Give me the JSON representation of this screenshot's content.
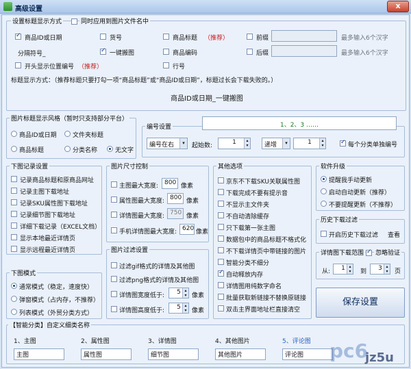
{
  "window": {
    "title": "高级设置",
    "close_label": "x"
  },
  "title_group": {
    "legend": "设置标题显示方式",
    "sync_label": "同时应用到图片文件名中",
    "opt_product_id_date": "商品ID或日期",
    "opt_sku": "货号",
    "opt_product_title": "商品标题",
    "opt_recommend": "（推荐）",
    "opt_prefix": "前缀",
    "hint_max6_a": "最多输入6个汉字",
    "separator_label": "分隔符号_",
    "opt_one_key": "一键搬图",
    "opt_product_code": "商品编码",
    "opt_suffix": "后缀",
    "hint_max6_b": "最多输入6个汉字",
    "opt_start_num": "开头显示位置编号",
    "opt_recommend2": "（推荐）",
    "opt_row": "行号",
    "method_text": "标题显示方式：（推荐标题只要打勾一项“商品标题”或“商品ID或日期”，标题过长会下载失败的。）",
    "preview_text": "商品ID或日期_一键搬图"
  },
  "style_group": {
    "legend": "图片标题显示风格（暂时只支持部分平台）",
    "opt_id_date": "商品ID或日期",
    "opt_filename": "文件夹标题",
    "opt_title": "商品标题",
    "opt_category": "分类名称",
    "opt_none": "无文字",
    "numbering_legend": "编号设置",
    "numbering_preview": "1、2、3 ……",
    "pos_select": "编号在右",
    "start_label": "起始数:",
    "start_value": "1",
    "increment_select": "递增",
    "step_value": "1",
    "per_category_label": "每个分类单独编号"
  },
  "record_group": {
    "legend": "下图记录设置",
    "items": [
      "记录商品标题和原商品网址",
      "记录主图下载地址",
      "记录SKU属性图下载地址",
      "记录细节图下载地址",
      "详细下载记录（EXCEL文档）",
      "显示本地最近详情页",
      "显示远程最近详情页"
    ]
  },
  "size_group": {
    "legend": "图片尺寸控制",
    "main_label": "主图最大宽度:",
    "main_value": "800",
    "main_unit": "像素",
    "attr_label": "属性图最大宽度:",
    "attr_value": "800",
    "attr_unit": "像素",
    "detail_label": "详情图最大宽度:",
    "detail_value": "750",
    "detail_unit": "像素",
    "mobile_label": "手机详情图最大宽度:",
    "mobile_value": "620",
    "mobile_unit": "像素"
  },
  "other_group": {
    "legend": "其他选项",
    "items": [
      "京东不下载SKU关联属性图",
      "下载完成不要有提示音",
      "不显示主文件夹",
      "不自动清除缓存",
      "只下载第一张主图",
      "数据包中的商品标题不格式化",
      "不下载详情页中带链接的图片",
      "智能分类不细分",
      "自动释放内存",
      "详情图用纯数字命名",
      "批量获取新链接不替换原链接",
      "双击主界面地址栏直接清空"
    ]
  },
  "upgrade_group": {
    "legend": "软件升级",
    "opt_remind": "提醒我手动更新",
    "opt_auto": "启动自动更新（推荐）",
    "opt_none": "不要提醒更新（不推荐）"
  },
  "history_group": {
    "legend": "历史下载过滤",
    "enable_label": "开启历史下载过滤",
    "view_label": "查看"
  },
  "detail_range_group": {
    "legend": "详情图下载范围",
    "ignore_label": "忽略验证",
    "from_label": "从:",
    "from_value": "1",
    "to_label": "到",
    "to_value": "3",
    "page_label": "页"
  },
  "save_button": "保存设置",
  "download_mode_group": {
    "legend": "下图模式",
    "opt_normal": "通常模式（稳定，速度快）",
    "opt_popup": "弹窗模式（占内存，不推荐）",
    "opt_list": "列表模式（外贸分类方式）"
  },
  "filter_group": {
    "legend": "图片过滤设置",
    "gif_label": "过滤gif格式的详情及其他图",
    "png_label": "过滤png格式的详情及其他图",
    "width_label": "详情图宽度低于:",
    "width_value": "5",
    "width_unit": "像素",
    "height_label": "详情图高度低于:",
    "height_value": "5",
    "height_unit": "像素"
  },
  "custom_group": {
    "legend": "【智能分类】自定义细类名称",
    "c1_label": "1、主图",
    "c1_value": "主图",
    "c2_label": "2、属性图",
    "c2_value": "属性图",
    "c3_label": "3、详情图",
    "c3_value": "细节图",
    "c4_label": "4、其他图片",
    "c4_value": "其他图片",
    "c5_label": "5、评论图",
    "c5_value": "评论图"
  },
  "watermark": {
    "text": "pc6",
    "site": "jz5u"
  }
}
